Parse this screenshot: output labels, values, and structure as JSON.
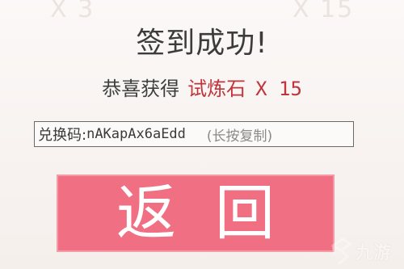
{
  "background_ghost_text": {
    "left": "X 3",
    "right": "X 15"
  },
  "dialog": {
    "title": "签到成功!",
    "reward_prefix": "恭喜获得",
    "reward_item": "试炼石",
    "reward_quantity": "X 15",
    "code_label": "兑换码:",
    "code_value": "nAKapAx6aEdd",
    "code_hint": "(长按复制)",
    "return_button_label": "返回"
  },
  "watermark": {
    "text": "九游"
  },
  "colors": {
    "accent_button": "#f06f82",
    "reward_highlight": "#c0343c"
  }
}
